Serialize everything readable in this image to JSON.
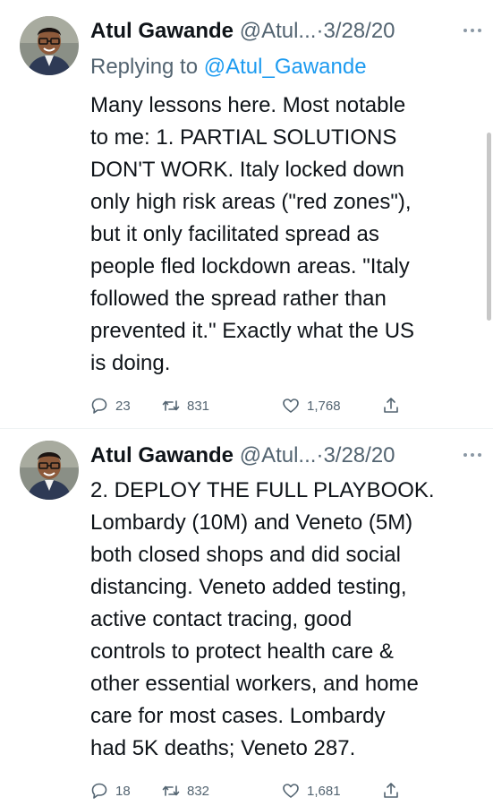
{
  "tweets": [
    {
      "name": "Atul Gawande",
      "handle": "@Atul...",
      "dot": "·",
      "date": "3/28/20",
      "replying_prefix": "Replying to ",
      "replying_to": "@Atul_Gawande",
      "lines": [
        "Many lessons here. Most notable",
        "to me: 1.  PARTIAL SOLUTIONS",
        "DON'T WORK. Italy locked down",
        "only high risk areas (\"red zones\"),",
        "but it only facilitated spread as",
        "people fled lockdown areas. \"Italy",
        "followed the spread rather than",
        "prevented it.\" Exactly what the US",
        "is doing."
      ],
      "replies": "23",
      "retweets": "831",
      "likes": "1,768"
    },
    {
      "name": "Atul Gawande",
      "handle": "@Atul...",
      "dot": "·",
      "date": "3/28/20",
      "lines": [
        "2. DEPLOY THE FULL PLAYBOOK.",
        "Lombardy (10M) and Veneto (5M)",
        "both closed shops and did social",
        "distancing. Veneto added testing,",
        "active contact tracing, good",
        "controls to protect health care &",
        "other essential workers, and home",
        "care for most cases. Lombardy",
        "had 5K deaths; Veneto 287."
      ],
      "replies": "18",
      "retweets": "832",
      "likes": "1,681"
    }
  ],
  "icons": {
    "reply": "reply-icon",
    "retweet": "retweet-icon",
    "like": "like-icon",
    "share": "share-icon",
    "more": "more-icon"
  },
  "colors": {
    "text": "#0f1419",
    "secondary": "#536471",
    "mention": "#1d9bf0"
  }
}
